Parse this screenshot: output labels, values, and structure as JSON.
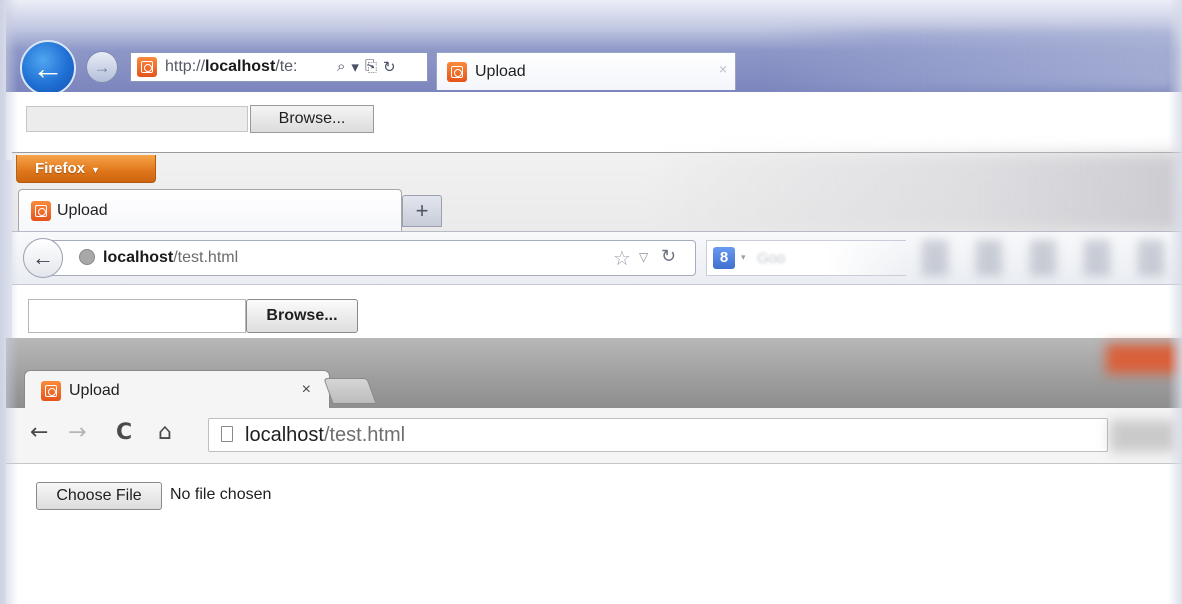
{
  "colors": {
    "ie_back": "#1f6fd4",
    "firefox_orange": "#e0761a",
    "favicon_orange": "#e4541a",
    "chrome_tabstrip": "#9d9d9d"
  },
  "ie": {
    "back_icon": "back-arrow-icon",
    "forward_icon": "forward-arrow-icon",
    "address": {
      "prefix": "http://",
      "host": "localhost",
      "suffix": "/te:",
      "search_glyph": "⌕",
      "dropdown_glyph": "▾",
      "compat_glyph": "⎘",
      "refresh_glyph": "↻"
    },
    "tab": {
      "label": "Upload",
      "close_glyph": "×"
    },
    "content": {
      "browse_label": "Browse..."
    }
  },
  "firefox": {
    "menu_label": "Firefox",
    "menu_caret": "▼",
    "tab": {
      "label": "Upload"
    },
    "new_tab_glyph": "+",
    "urlbar": {
      "back_glyph": "←",
      "host": "localhost",
      "path": "/test.html",
      "star_glyph": "☆",
      "dropmarker_glyph": "▽",
      "reload_glyph": "↻"
    },
    "search": {
      "engine_glyph": "8",
      "caret_glyph": "▾",
      "placeholder": "Goo"
    },
    "content": {
      "browse_label": "Browse..."
    }
  },
  "chrome": {
    "tab": {
      "label": "Upload",
      "close_glyph": "×"
    },
    "toolbar": {
      "back_glyph": "←",
      "forward_glyph": "→",
      "reload_glyph": "C",
      "home_glyph": "⌂"
    },
    "omnibox": {
      "host": "localhost",
      "path": "/test.html"
    },
    "content": {
      "choose_label": "Choose File",
      "status": "No file chosen"
    }
  }
}
